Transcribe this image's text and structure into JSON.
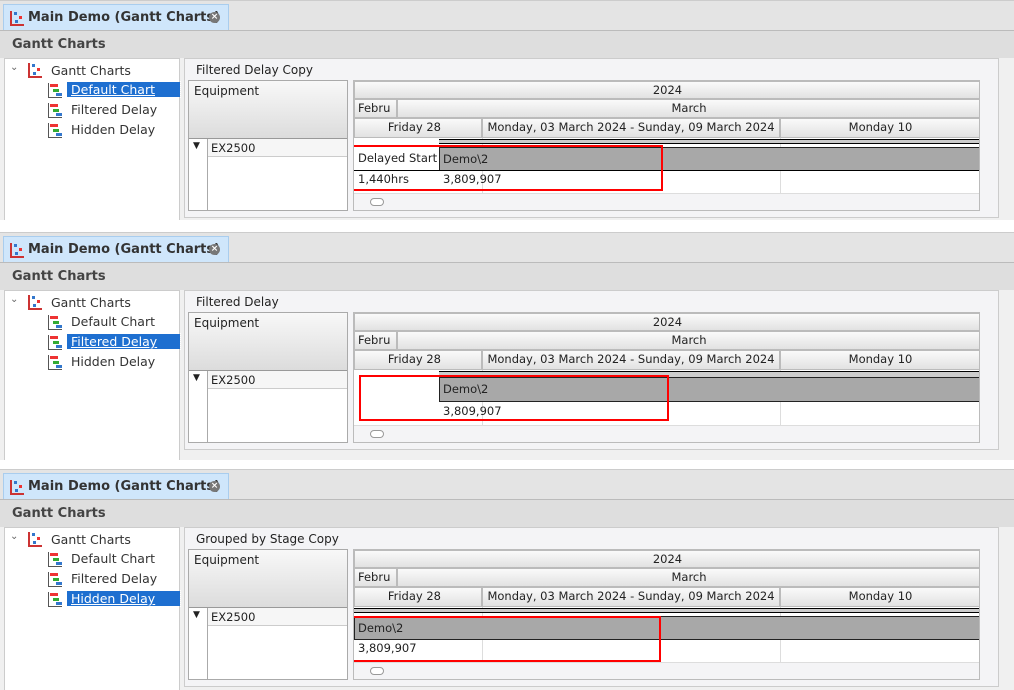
{
  "colors": {
    "accent": "#1e6fd0",
    "highlight": "#ff0000",
    "bar": "#a8a8a8"
  },
  "panels": [
    {
      "tab": "Main Demo (Gantt Charts)",
      "header": "Gantt Charts",
      "tree": {
        "root": "Gantt Charts",
        "items": [
          "Default Chart",
          "Filtered Delay",
          "Hidden Delay"
        ],
        "selected": 0
      },
      "chart_title": "Filtered Delay Copy",
      "equipment_header": "Equipment",
      "equipment_row": "EX2500",
      "timeline": {
        "year": "2024",
        "month_prev": "Febru",
        "month": "March",
        "day1": "Friday 28",
        "week": "Monday, 03 March 2024 - Sunday, 09 March 2024",
        "day2": "Monday 10"
      },
      "delay_label": "Delayed Start",
      "delay_value": "1,440hrs",
      "bar_label": "Demo\\2",
      "bar_value": "3,809,907",
      "mode": "shown"
    },
    {
      "tab": "Main Demo (Gantt Charts)",
      "header": "Gantt Charts",
      "tree": {
        "root": "Gantt Charts",
        "items": [
          "Default Chart",
          "Filtered Delay",
          "Hidden Delay"
        ],
        "selected": 1
      },
      "chart_title": "Filtered Delay",
      "equipment_header": "Equipment",
      "equipment_row": "EX2500",
      "timeline": {
        "year": "2024",
        "month_prev": "Febru",
        "month": "March",
        "day1": "Friday 28",
        "week": "Monday, 03 March 2024 - Sunday, 09 March 2024",
        "day2": "Monday 10"
      },
      "bar_label": "Demo\\2",
      "bar_value": "3,809,907",
      "mode": "filtered"
    },
    {
      "tab": "Main Demo (Gantt Charts)",
      "header": "Gantt Charts",
      "tree": {
        "root": "Gantt Charts",
        "items": [
          "Default Chart",
          "Filtered Delay",
          "Hidden Delay"
        ],
        "selected": 2
      },
      "chart_title": "Grouped by Stage Copy",
      "equipment_header": "Equipment",
      "equipment_row": "EX2500",
      "timeline": {
        "year": "2024",
        "month_prev": "Febru",
        "month": "March",
        "day1": "Friday 28",
        "week": "Monday, 03 March 2024 - Sunday, 09 March 2024",
        "day2": "Monday 10"
      },
      "bar_label": "Demo\\2",
      "bar_value": "3,809,907",
      "mode": "hidden"
    }
  ]
}
